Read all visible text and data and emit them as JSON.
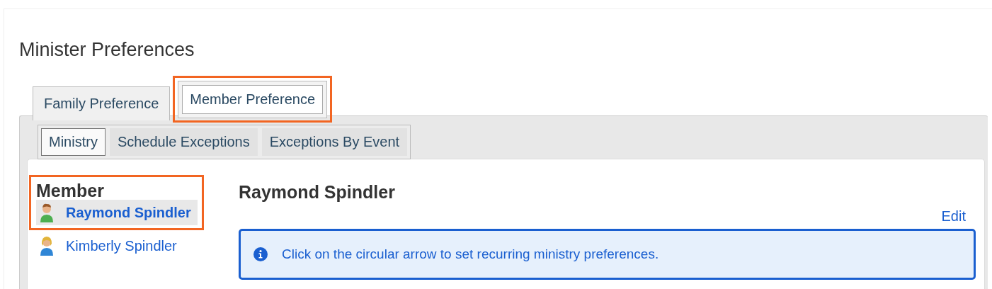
{
  "page_title": "Minister Preferences",
  "tabs": [
    {
      "label": "Family Preference",
      "selected": false,
      "highlighted": false
    },
    {
      "label": "Member Preference",
      "selected": true,
      "highlighted": true
    }
  ],
  "sub_tabs": [
    {
      "label": "Ministry",
      "selected": true
    },
    {
      "label": "Schedule Exceptions",
      "selected": false
    },
    {
      "label": "Exceptions By Event",
      "selected": false
    }
  ],
  "member_panel": {
    "heading": "Member",
    "highlighted": true,
    "members": [
      {
        "name": "Raymond Spindler",
        "kind": "male",
        "selected": true
      },
      {
        "name": "Kimberly Spindler",
        "kind": "female",
        "selected": false
      }
    ]
  },
  "detail": {
    "name": "Raymond Spindler",
    "edit_link": "Edit",
    "info": "Click on the circular arrow to set recurring ministry preferences."
  }
}
